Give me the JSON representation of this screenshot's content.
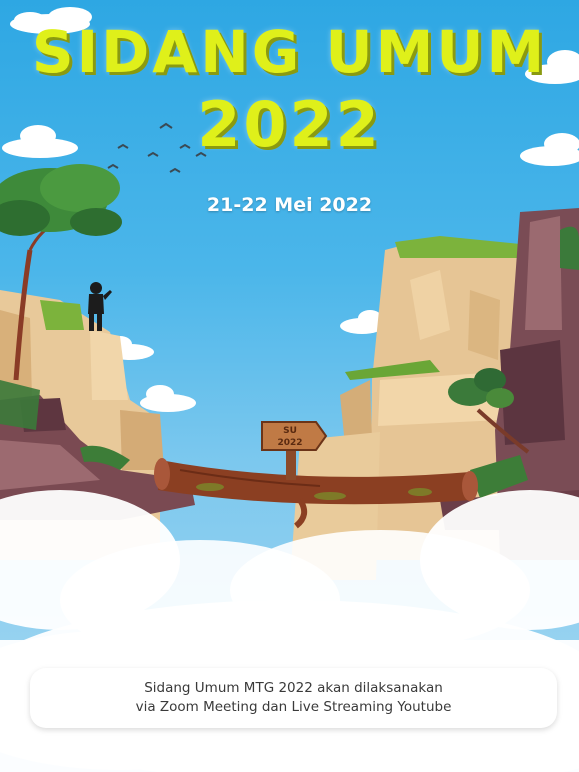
{
  "title": {
    "line1": "SIDANG UMUM",
    "line2": "2022"
  },
  "date": "21-22 Mei 2022",
  "sign": {
    "line1": "SU",
    "line2": "2022"
  },
  "info": {
    "line1": "Sidang Umum MTG 2022 akan dilaksanakan",
    "line2": "via Zoom Meeting dan Live Streaming Youtube"
  },
  "colors": {
    "sky": "#2ea7e3",
    "title": "#dff01a",
    "cliff": "#e8c99a",
    "rock": "#7a4a52",
    "log": "#8b3f22",
    "leaf": "#4a8a3a"
  }
}
